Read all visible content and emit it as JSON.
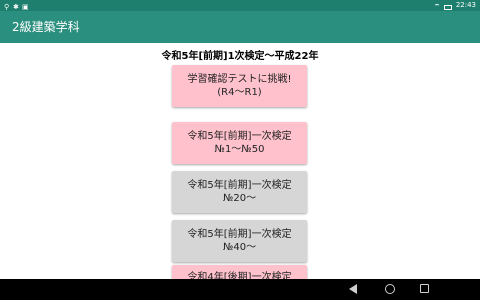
{
  "status_bar": {
    "time": "22:43"
  },
  "app_bar": {
    "title": "2級建築学科"
  },
  "subtitle": "令和5年[前期]1次検定〜平成22年",
  "items": [
    {
      "line1": "学習確認テストに挑戦!",
      "line2": "(R4〜R1)",
      "color": "#ffc2cc"
    },
    {
      "line1": "令和5年[前期]一次検定",
      "line2": "№1〜№50",
      "color": "#ffc2cc"
    },
    {
      "line1": "令和5年[前期]一次検定",
      "line2": "№20〜",
      "color": "#d6d6d6"
    },
    {
      "line1": "令和5年[前期]一次検定",
      "line2": "№40〜",
      "color": "#d6d6d6"
    },
    {
      "line1": "令和4年[後期]一次検定",
      "line2": "",
      "color": "#ffc2cc"
    }
  ]
}
